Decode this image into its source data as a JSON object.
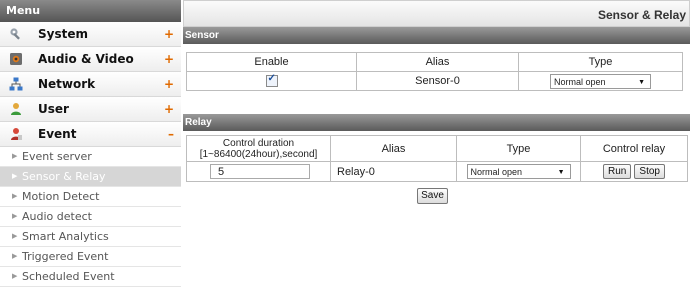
{
  "menu": {
    "title": "Menu",
    "items": [
      {
        "label": "System",
        "icon": "wrench-icon",
        "sign": "+"
      },
      {
        "label": "Audio & Video",
        "icon": "camera-icon",
        "sign": "+"
      },
      {
        "label": "Network",
        "icon": "network-icon",
        "sign": "+"
      },
      {
        "label": "User",
        "icon": "user-icon",
        "sign": "+"
      },
      {
        "label": "Event",
        "icon": "event-icon",
        "sign": "–"
      }
    ],
    "event_subitems": [
      {
        "label": "Event server"
      },
      {
        "label": "Sensor & Relay",
        "active": true
      },
      {
        "label": "Motion Detect"
      },
      {
        "label": "Audio detect"
      },
      {
        "label": "Smart Analytics"
      },
      {
        "label": "Triggered Event"
      },
      {
        "label": "Scheduled Event"
      }
    ]
  },
  "page": {
    "title": "Sensor & Relay"
  },
  "sensor": {
    "section_title": "Sensor",
    "headers": {
      "enable": "Enable",
      "alias": "Alias",
      "type": "Type"
    },
    "row": {
      "enabled": true,
      "alias": "Sensor-0",
      "type": "Normal open"
    }
  },
  "relay": {
    "section_title": "Relay",
    "headers": {
      "control_duration": "Control duration",
      "control_duration_range": "[1~86400(24hour),second]",
      "alias": "Alias",
      "type": "Type",
      "control_relay": "Control relay"
    },
    "row": {
      "duration": "5",
      "alias": "Relay-0",
      "type": "Normal open",
      "run_label": "Run",
      "stop_label": "Stop"
    }
  },
  "save_label": "Save",
  "colors": {
    "accent_sign": "#e06a00",
    "section_bar": "#6e6e6e",
    "active_subitem": "#d6d6d6"
  }
}
